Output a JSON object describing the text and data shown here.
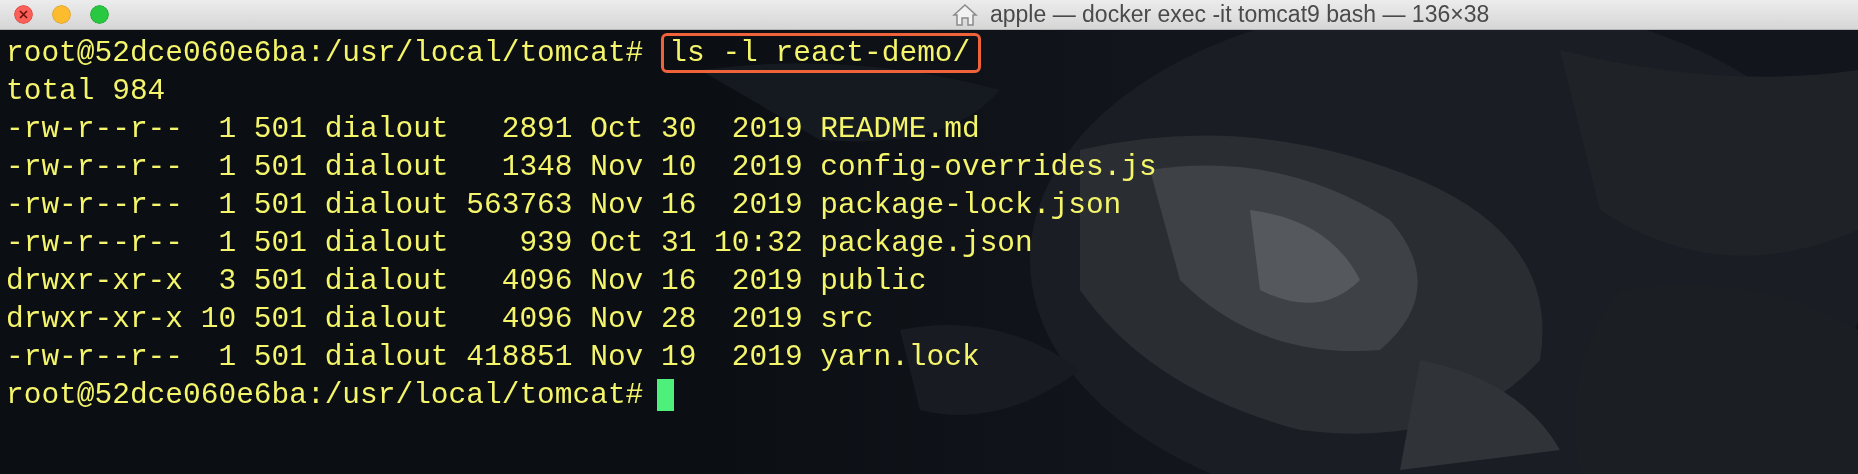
{
  "window": {
    "title": "apple — docker exec -it tomcat9 bash — 136×38"
  },
  "lines": [
    {
      "kind": "prompt",
      "prompt": "root@52dce060e6ba:/usr/local/tomcat#",
      "command": "ls -l react-demo/",
      "highlighted": true,
      "cursor": false
    },
    {
      "kind": "output",
      "text": "total 984"
    },
    {
      "kind": "output",
      "text": "-rw-r--r--  1 501 dialout   2891 Oct 30  2019 README.md"
    },
    {
      "kind": "output",
      "text": "-rw-r--r--  1 501 dialout   1348 Nov 10  2019 config-overrides.js"
    },
    {
      "kind": "output",
      "text": "-rw-r--r--  1 501 dialout 563763 Nov 16  2019 package-lock.json"
    },
    {
      "kind": "output",
      "text": "-rw-r--r--  1 501 dialout    939 Oct 31 10:32 package.json"
    },
    {
      "kind": "output",
      "text": "drwxr-xr-x  3 501 dialout   4096 Nov 16  2019 public"
    },
    {
      "kind": "output",
      "text": "drwxr-xr-x 10 501 dialout   4096 Nov 28  2019 src"
    },
    {
      "kind": "output",
      "text": "-rw-r--r--  1 501 dialout 418851 Nov 19  2019 yarn.lock"
    },
    {
      "kind": "prompt",
      "prompt": "root@52dce060e6ba:/usr/local/tomcat#",
      "cursor": true
    }
  ]
}
